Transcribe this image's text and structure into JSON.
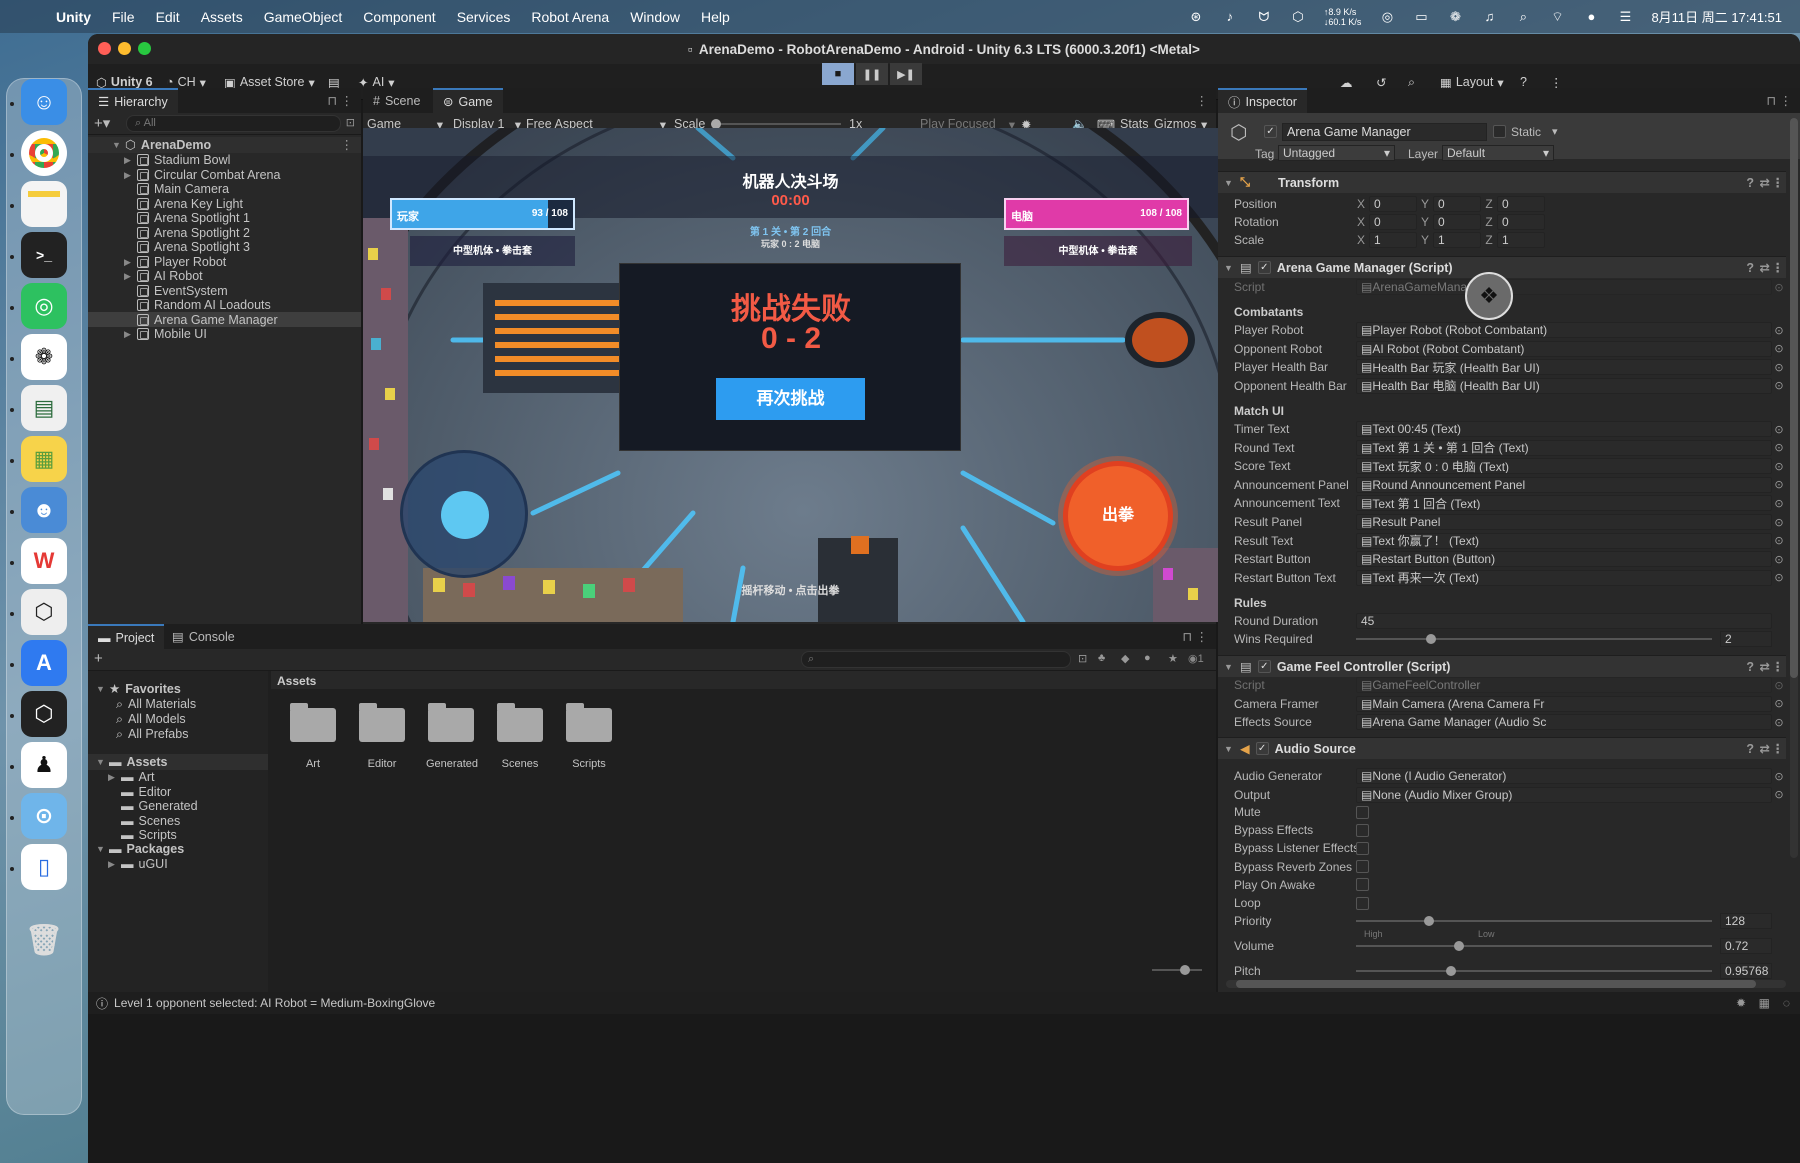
{
  "menubar": {
    "app": "Unity",
    "items": [
      "File",
      "Edit",
      "Assets",
      "GameObject",
      "Component",
      "Services",
      "Robot Arena",
      "Window",
      "Help"
    ],
    "net_up": "↑8.9 K/s",
    "net_down": "↓60.1 K/s",
    "datetime": "8月11日 周二  17:41:51"
  },
  "window": {
    "title": "ArenaDemo - RobotArenaDemo - Android - Unity 6.3 LTS (6000.3.20f1) <Metal>"
  },
  "toolbar": {
    "unity": "Unity 6",
    "account": "CH",
    "asset_store": "Asset Store",
    "ai": "AI",
    "layout": "Layout"
  },
  "hierarchy": {
    "tab": "Hierarchy",
    "search_placeholder": "All",
    "scene": "ArenaDemo",
    "items": [
      "Stadium Bowl",
      "Circular Combat Arena",
      "Main Camera",
      "Arena Key Light",
      "Arena Spotlight 1",
      "Arena Spotlight 2",
      "Arena Spotlight 3",
      "Player Robot",
      "AI Robot",
      "EventSystem",
      "Random AI Loadouts",
      "Arena Game Manager",
      "Mobile UI"
    ]
  },
  "game": {
    "tab_scene": "Scene",
    "tab_game": "Game",
    "view": "Game",
    "display": "Display 1",
    "aspect": "Free Aspect",
    "scale_label": "Scale",
    "scale_value": "1x",
    "play_focused": "Play Focused",
    "stats": "Stats",
    "gizmos": "Gizmos",
    "hud": {
      "title": "机器人决斗场",
      "timer": "00:00",
      "player_label": "玩家",
      "player_hp": "93 / 108",
      "player_hp_fraction": 0.86,
      "enemy_label": "电脑",
      "enemy_hp": "108 / 108",
      "enemy_hp_fraction": 1.0,
      "round": "第 1 关 • 第 2 回合",
      "score": "玩家 0 : 2 电脑",
      "player_loadout": "中型机体 • 拳击套",
      "enemy_loadout": "中型机体 • 拳击套",
      "result_title": "挑战失败",
      "result_score": "0 - 2",
      "retry": "再次挑战",
      "punch": "出拳",
      "hint": "摇杆移动 • 点击出拳"
    }
  },
  "project": {
    "tab_project": "Project",
    "tab_console": "Console",
    "favorites": "Favorites",
    "fav_items": [
      "All Materials",
      "All Models",
      "All Prefabs"
    ],
    "assets": "Assets",
    "asset_folders": [
      "Art",
      "Editor",
      "Generated",
      "Scenes",
      "Scripts"
    ],
    "packages": "Packages",
    "package_items": [
      "uGUI"
    ],
    "breadcrumb": "Assets",
    "hidden_count": "1"
  },
  "inspector": {
    "tab": "Inspector",
    "object_name": "Arena Game Manager",
    "static": "Static",
    "tag_label": "Tag",
    "tag": "Untagged",
    "layer_label": "Layer",
    "layer": "Default",
    "transform": {
      "title": "Transform",
      "rows": [
        {
          "label": "Position",
          "x": "0",
          "y": "0",
          "z": "0"
        },
        {
          "label": "Rotation",
          "x": "0",
          "y": "0",
          "z": "0"
        },
        {
          "label": "Scale",
          "x": "1",
          "y": "1",
          "z": "1"
        }
      ]
    },
    "agm": {
      "title": "Arena Game Manager (Script)",
      "script_label": "Script",
      "script": "ArenaGameManager",
      "combatants": "Combatants",
      "combatant_rows": [
        {
          "label": "Player Robot",
          "value": "Player Robot (Robot Combatant)"
        },
        {
          "label": "Opponent Robot",
          "value": "AI Robot (Robot Combatant)"
        },
        {
          "label": "Player Health Bar",
          "value": "Health Bar 玩家 (Health Bar UI)"
        },
        {
          "label": "Opponent Health Bar",
          "value": "Health Bar 电脑 (Health Bar UI)"
        }
      ],
      "match_ui": "Match UI",
      "match_rows": [
        {
          "label": "Timer Text",
          "value": "Text 00:45 (Text)"
        },
        {
          "label": "Round Text",
          "value": "Text 第 1 关 • 第 1 回合 (Text)"
        },
        {
          "label": "Score Text",
          "value": "Text 玩家 0 : 0 电脑 (Text)"
        },
        {
          "label": "Announcement Panel",
          "value": "Round Announcement Panel"
        },
        {
          "label": "Announcement Text",
          "value": "Text 第 1 回合 (Text)"
        },
        {
          "label": "Result Panel",
          "value": "Result Panel"
        },
        {
          "label": "Result Text",
          "value": "Text 你赢了！ (Text)"
        },
        {
          "label": "Restart Button",
          "value": "Restart Button (Button)"
        },
        {
          "label": "Restart Button Text",
          "value": "Text 再来一次 (Text)"
        }
      ],
      "rules": "Rules",
      "round_duration_label": "Round Duration",
      "round_duration": "45",
      "wins_required_label": "Wins Required",
      "wins_required": "2"
    },
    "gfc": {
      "title": "Game Feel Controller (Script)",
      "rows": [
        {
          "label": "Script",
          "value": "GameFeelController"
        },
        {
          "label": "Camera Framer",
          "value": "Main Camera (Arena Camera Fr"
        },
        {
          "label": "Effects Source",
          "value": "Arena Game Manager (Audio Sc"
        }
      ]
    },
    "audio": {
      "title": "Audio Source",
      "rows": [
        {
          "label": "Audio Generator",
          "value": "None (I Audio Generator)"
        },
        {
          "label": "Output",
          "value": "None (Audio Mixer Group)"
        }
      ],
      "toggles": [
        "Mute",
        "Bypass Effects",
        "Bypass Listener Effects",
        "Bypass Reverb Zones",
        "Play On Awake",
        "Loop"
      ],
      "priority_label": "Priority",
      "priority": "128",
      "high": "High",
      "low": "Low",
      "volume_label": "Volume",
      "volume": "0.72",
      "pitch_label": "Pitch",
      "pitch": "0.95768"
    }
  },
  "status": {
    "message": "Level 1 opponent selected: AI Robot = Medium-BoxingGlove"
  }
}
